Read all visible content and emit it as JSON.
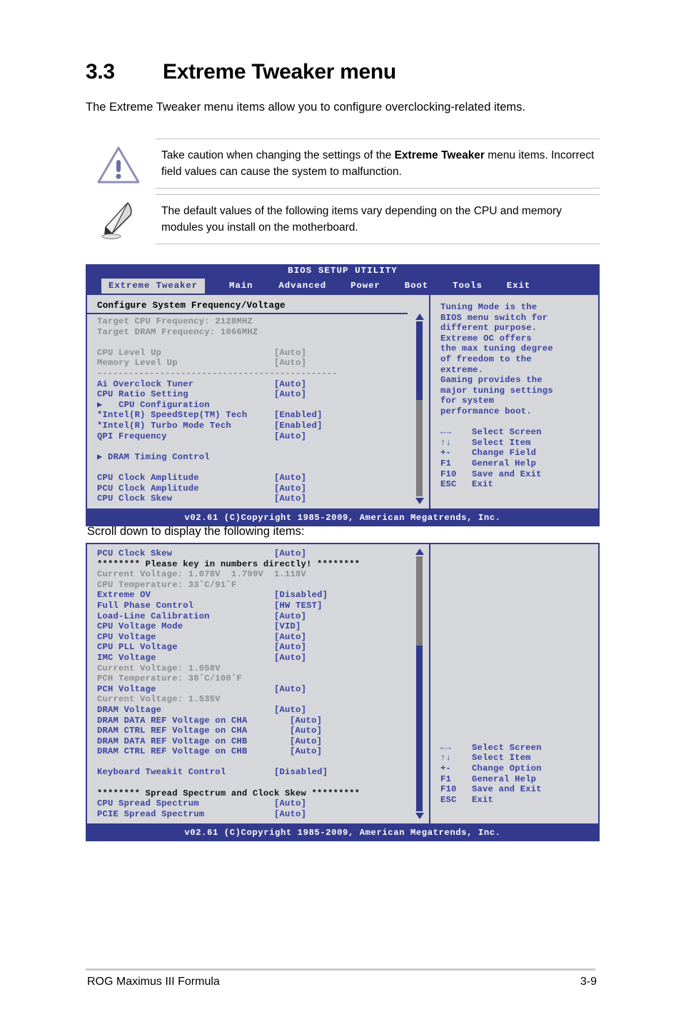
{
  "heading": {
    "number": "3.3",
    "title": "Extreme Tweaker menu"
  },
  "intro": "The Extreme Tweaker menu items allow you to configure overclocking-related items.",
  "callouts": {
    "warning": {
      "icon": "warning-triangle-icon",
      "text_before": "Take caution when changing the settings of the ",
      "text_bold": "Extreme Tweaker",
      "text_after": " menu items. Incorrect field values can cause the system to malfunction."
    },
    "note": {
      "icon": "quill-pen-icon",
      "text": "The default values of the following items vary depending on the CPU and memory modules you install on the motherboard."
    }
  },
  "scroll_note": "Scroll down to display the following items:",
  "bios": {
    "title": "BIOS SETUP UTILITY",
    "tabs": [
      {
        "label": "Extreme Tweaker",
        "active": true
      },
      {
        "label": "Main",
        "active": false
      },
      {
        "label": "Advanced",
        "active": false
      },
      {
        "label": "Power",
        "active": false
      },
      {
        "label": "Boot",
        "active": false
      },
      {
        "label": "Tools",
        "active": false
      },
      {
        "label": "Exit",
        "active": false
      }
    ],
    "footer": "v02.61 (C)Copyright 1985-2009, American Megatrends, Inc.",
    "colors": {
      "chrome": "#333a8e",
      "panel": "#d5d7da",
      "item_text": "#3a42a0",
      "dim_text": "#8b8d90",
      "tab_active_bg": "#d5d5d5"
    }
  },
  "screen1": {
    "section_title": "Configure System Frequency/Voltage",
    "rows": [
      {
        "label": "Target CPU Frequency: 2128MHZ",
        "value": "",
        "style": "dim"
      },
      {
        "label": "Target DRAM Frequency: 1066MHZ",
        "value": "",
        "style": "dim"
      },
      {
        "label": "",
        "value": "",
        "style": "spacer"
      },
      {
        "label": "CPU Level Up",
        "value": "[Auto]",
        "style": "dim"
      },
      {
        "label": "Memory Level Up",
        "value": "[Auto]",
        "style": "dim"
      },
      {
        "label": "----------------------------------------------",
        "value": "",
        "style": "dash"
      },
      {
        "label": "Ai Overclock Tuner",
        "value": "[Auto]",
        "style": "normal"
      },
      {
        "label": "CPU Ratio Setting",
        "value": "[Auto]",
        "style": "normal"
      },
      {
        "label": "▶   CPU Configuration",
        "value": "",
        "style": "normal"
      },
      {
        "label": "*Intel(R) SpeedStep(TM) Tech",
        "value": "[Enabled]",
        "style": "normal"
      },
      {
        "label": "*Intel(R) Turbo Mode Tech",
        "value": "[Enabled]",
        "style": "normal"
      },
      {
        "label": "QPI Frequency",
        "value": "[Auto]",
        "style": "normal"
      },
      {
        "label": "",
        "value": "",
        "style": "spacer"
      },
      {
        "label": "▶ DRAM Timing Control",
        "value": "",
        "style": "normal"
      },
      {
        "label": "",
        "value": "",
        "style": "spacer"
      },
      {
        "label": "CPU Clock Amplitude",
        "value": "[Auto]",
        "style": "normal"
      },
      {
        "label": "PCU Clock Amplitude",
        "value": "[Auto]",
        "style": "normal"
      },
      {
        "label": "CPU Clock Skew",
        "value": "[Auto]",
        "style": "normal"
      }
    ],
    "scrollbar": {
      "thumb_top_percent": 0,
      "thumb_height_percent": 45
    },
    "help_text": "Tuning Mode is the\nBIOS menu switch for\ndifferent purpose.\nExtreme OC offers\nthe max tuning degree\nof freedom to the\nextreme.\nGaming provides the\nmajor tuning settings\nfor system\nperformance boot.",
    "help_keys": [
      {
        "key": "←→",
        "desc": "Select Screen"
      },
      {
        "key": "↑↓",
        "desc": "Select Item"
      },
      {
        "key": "+-",
        "desc": "Change Field"
      },
      {
        "key": "F1",
        "desc": "General Help"
      },
      {
        "key": "F10",
        "desc": "Save and Exit"
      },
      {
        "key": "ESC",
        "desc": "Exit"
      }
    ]
  },
  "screen2": {
    "rows": [
      {
        "label": "PCU Clock Skew",
        "value": "[Auto]",
        "style": "normal"
      },
      {
        "label": "******** Please key in numbers directly! ********",
        "value": "",
        "style": "banner"
      },
      {
        "label": "Current Voltage: 1.078V  1.799V  1.118V",
        "value": "",
        "style": "dim"
      },
      {
        "label": "CPU Temperature: 33˚C/91˚F",
        "value": "",
        "style": "dim"
      },
      {
        "label": "Extreme OV",
        "value": "[Disabled]",
        "style": "normal"
      },
      {
        "label": "Full Phase Control",
        "value": "[HW TEST]",
        "style": "normal"
      },
      {
        "label": "Load-Line Calibration",
        "value": "[Auto]",
        "style": "normal"
      },
      {
        "label": "CPU Voltage Mode",
        "value": "[VID]",
        "style": "normal"
      },
      {
        "label": "CPU Voltage",
        "value": "[Auto]",
        "style": "normal"
      },
      {
        "label": "CPU PLL Voltage",
        "value": "[Auto]",
        "style": "normal"
      },
      {
        "label": "IMC Voltage",
        "value": "[Auto]",
        "style": "normal"
      },
      {
        "label": "Current Voltage: 1.058V",
        "value": "",
        "style": "dim"
      },
      {
        "label": "PCH Temperature: 38˚C/100˚F",
        "value": "",
        "style": "dim"
      },
      {
        "label": "PCH Voltage",
        "value": "[Auto]",
        "style": "normal"
      },
      {
        "label": "Current Voltage: 1.535V",
        "value": "",
        "style": "dim"
      },
      {
        "label": "DRAM Voltage",
        "value": "[Auto]",
        "style": "normal"
      },
      {
        "label": "DRAM DATA REF Voltage on CHA",
        "value": "[Auto]",
        "style": "wide"
      },
      {
        "label": "DRAM CTRL REF Voltage on CHA",
        "value": "[Auto]",
        "style": "wide"
      },
      {
        "label": "DRAM DATA REF Voltage on CHB",
        "value": "[Auto]",
        "style": "wide"
      },
      {
        "label": "DRAM CTRL REF Voltage on CHB",
        "value": "[Auto]",
        "style": "wide"
      },
      {
        "label": "",
        "value": "",
        "style": "spacer"
      },
      {
        "label": "Keyboard Tweakit Control",
        "value": "[Disabled]",
        "style": "normal"
      },
      {
        "label": "",
        "value": "",
        "style": "spacer"
      },
      {
        "label": "******** Spread Spectrum and Clock Skew *********",
        "value": "",
        "style": "banner"
      },
      {
        "label": "CPU Spread Spectrum",
        "value": "[Auto]",
        "style": "normal"
      },
      {
        "label": "PCIE Spread Spectrum",
        "value": "[Auto]",
        "style": "normal"
      }
    ],
    "scrollbar": {
      "thumb_top_percent": 35,
      "thumb_height_percent": 65
    },
    "help_keys": [
      {
        "key": "←→",
        "desc": "Select Screen"
      },
      {
        "key": "↑↓",
        "desc": "Select Item"
      },
      {
        "key": "+-",
        "desc": "Change Option"
      },
      {
        "key": "F1",
        "desc": "General Help"
      },
      {
        "key": "F10",
        "desc": "Save and Exit"
      },
      {
        "key": "ESC",
        "desc": "Exit"
      }
    ]
  },
  "page_footer": {
    "left": "ROG Maximus III Formula",
    "right": "3-9"
  }
}
